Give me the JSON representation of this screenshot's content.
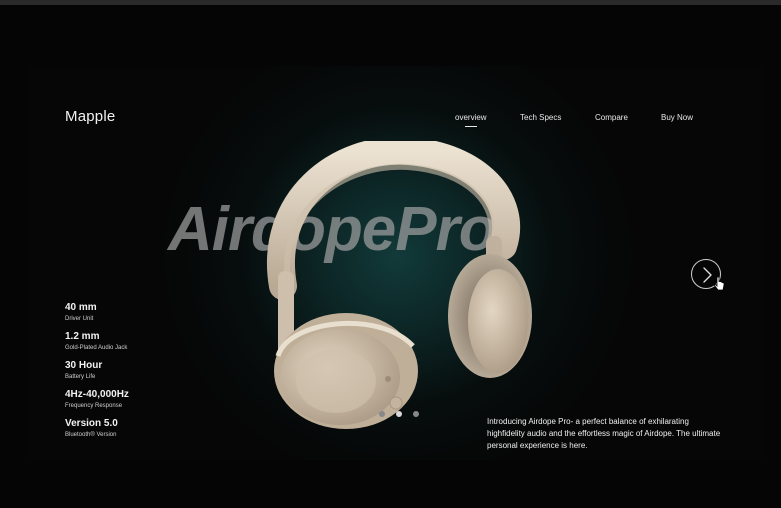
{
  "brand": {
    "logo": "Mapple"
  },
  "nav": {
    "items": [
      {
        "label": "overview",
        "active": true
      },
      {
        "label": "Tech Specs",
        "active": false
      },
      {
        "label": "Compare",
        "active": false
      },
      {
        "label": "Buy Now",
        "active": false
      }
    ]
  },
  "hero": {
    "title": "AirdopePro",
    "product_image": "headphones-image"
  },
  "specs": [
    {
      "value": "40 mm",
      "label": "Driver Unit"
    },
    {
      "value": "1.2 mm",
      "label": "Gold-Plated Audio Jack"
    },
    {
      "value": "30 Hour",
      "label": "Battery Life"
    },
    {
      "value": "4Hz-40,000Hz",
      "label": "Frequency Response"
    },
    {
      "value": "Version 5.0",
      "label": "Bluetooth®  Version"
    }
  ],
  "carousel": {
    "slide_count": 3,
    "active_index": 1,
    "next_icon": "chevron-right-icon"
  },
  "description": "Introducing Airdope Pro- a perfect balance  of exhilarating highfidelity audio and the effortless  magic of Airdope. The ultimate personal experience is here.",
  "colors": {
    "background": "#050505",
    "glow": "#123a3a",
    "headphone": "#d9cbb7",
    "text": "#f2f2f2"
  }
}
